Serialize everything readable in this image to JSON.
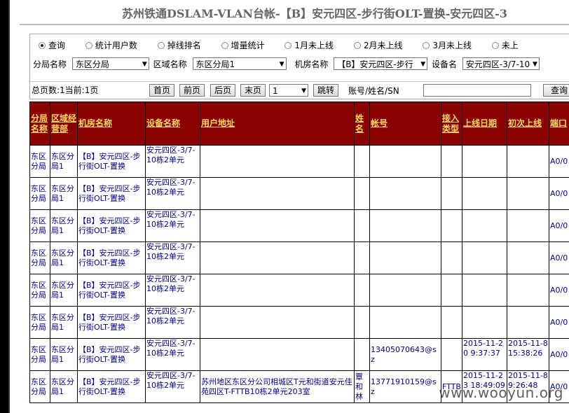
{
  "title": "苏州铁通DSLAM-VLAN台帐-【B】安元四区-步行街OLT-置换-安元四区-3",
  "radios": [
    {
      "label": "查询",
      "checked": true
    },
    {
      "label": "统计用户数",
      "checked": false
    },
    {
      "label": "掉线排名",
      "checked": false
    },
    {
      "label": "增量统计",
      "checked": false
    },
    {
      "label": "1月未上线",
      "checked": false
    },
    {
      "label": "2月未上线",
      "checked": false
    },
    {
      "label": "3月未上线",
      "checked": false
    },
    {
      "label": "未上",
      "checked": false
    }
  ],
  "filters": {
    "branch_label": "分局名称",
    "branch_value": "东区分局",
    "area_label": "区域名称",
    "area_value": "东区分局1",
    "room_label": "机房名称",
    "room_value": "【B】安元四区-步行",
    "device_label": "设备名",
    "device_value": "安元四区-3/7-10"
  },
  "pager": {
    "info": "总页数:1当前:1页",
    "first": "首页",
    "prev": "前页",
    "next": "后页",
    "last": "末页",
    "page_select": "1",
    "jump": "跳转",
    "search_label": "账号/姓名/SN",
    "search_value": "",
    "query": "查询"
  },
  "table": {
    "headers": [
      "分局名称",
      "区域经营部",
      "机房名称",
      "设备名称",
      "用户地址",
      "姓名",
      "帐号",
      "接入类型",
      "上线日期",
      "初次上线",
      "端口"
    ],
    "rows": [
      {
        "branch": "东区分局",
        "area": "东区分局1",
        "room": "【B】安元四区-步行街OLT-置换",
        "device": "安元四区-3/7-10栋2单元",
        "address": "",
        "name": "",
        "account": "",
        "access": "",
        "online": "",
        "first": "",
        "port": "A0/0"
      },
      {
        "branch": "东区分局",
        "area": "东区分局1",
        "room": "【B】安元四区-步行街OLT-置换",
        "device": "安元四区-3/7-10栋2单元",
        "address": "",
        "name": "",
        "account": "",
        "access": "",
        "online": "",
        "first": "",
        "port": "A0/0"
      },
      {
        "branch": "东区分局",
        "area": "东区分局1",
        "room": "【B】安元四区-步行街OLT-置换",
        "device": "安元四区-3/7-10栋2单元",
        "address": "",
        "name": "",
        "account": "",
        "access": "",
        "online": "",
        "first": "",
        "port": "A0/0"
      },
      {
        "branch": "东区分局",
        "area": "东区分局1",
        "room": "【B】安元四区-步行街OLT-置换",
        "device": "安元四区-3/7-10栋2单元",
        "address": "",
        "name": "",
        "account": "",
        "access": "",
        "online": "",
        "first": "",
        "port": "A0/0"
      },
      {
        "branch": "东区分局",
        "area": "东区分局1",
        "room": "【B】安元四区-步行街OLT-置换",
        "device": "安元四区-3/7-10栋2单元",
        "address": "",
        "name": "",
        "account": "",
        "access": "",
        "online": "",
        "first": "",
        "port": "A0/0"
      },
      {
        "branch": "东区分局",
        "area": "东区分局1",
        "room": "【B】安元四区-步行街OLT-置换",
        "device": "安元四区-3/7-10栋2单元",
        "address": "",
        "name": "",
        "account": "",
        "access": "",
        "online": "",
        "first": "",
        "port": "A0/0"
      },
      {
        "branch": "东区分局",
        "area": "东区分局1",
        "room": "【B】安元四区-步行街OLT-置换",
        "device": "安元四区-3/7-10栋2单元",
        "address": "",
        "name": "",
        "account": "13405070643@sz",
        "access": "",
        "online": "2015-11-20 9:37:37",
        "first": "2015-11-8 15:38:26",
        "port": "A0/0"
      },
      {
        "branch": "东区分局",
        "area": "东区分局1",
        "room": "【B】安元四区-步行街OLT-置换",
        "device": "安元四区-3/7-10栋2单元",
        "address": "苏州地区东区分公司相城区T元和街道安元佳苑四区T-FTTB10栋2单元203室",
        "name": "覃和林",
        "account": "13771910159@sz",
        "access": "FTTB",
        "online": "2015-11-23 18:49:09",
        "first": "2015-11-8 9:26:48",
        "port": "A0/0"
      }
    ]
  },
  "watermark": "www.wooyun.org"
}
